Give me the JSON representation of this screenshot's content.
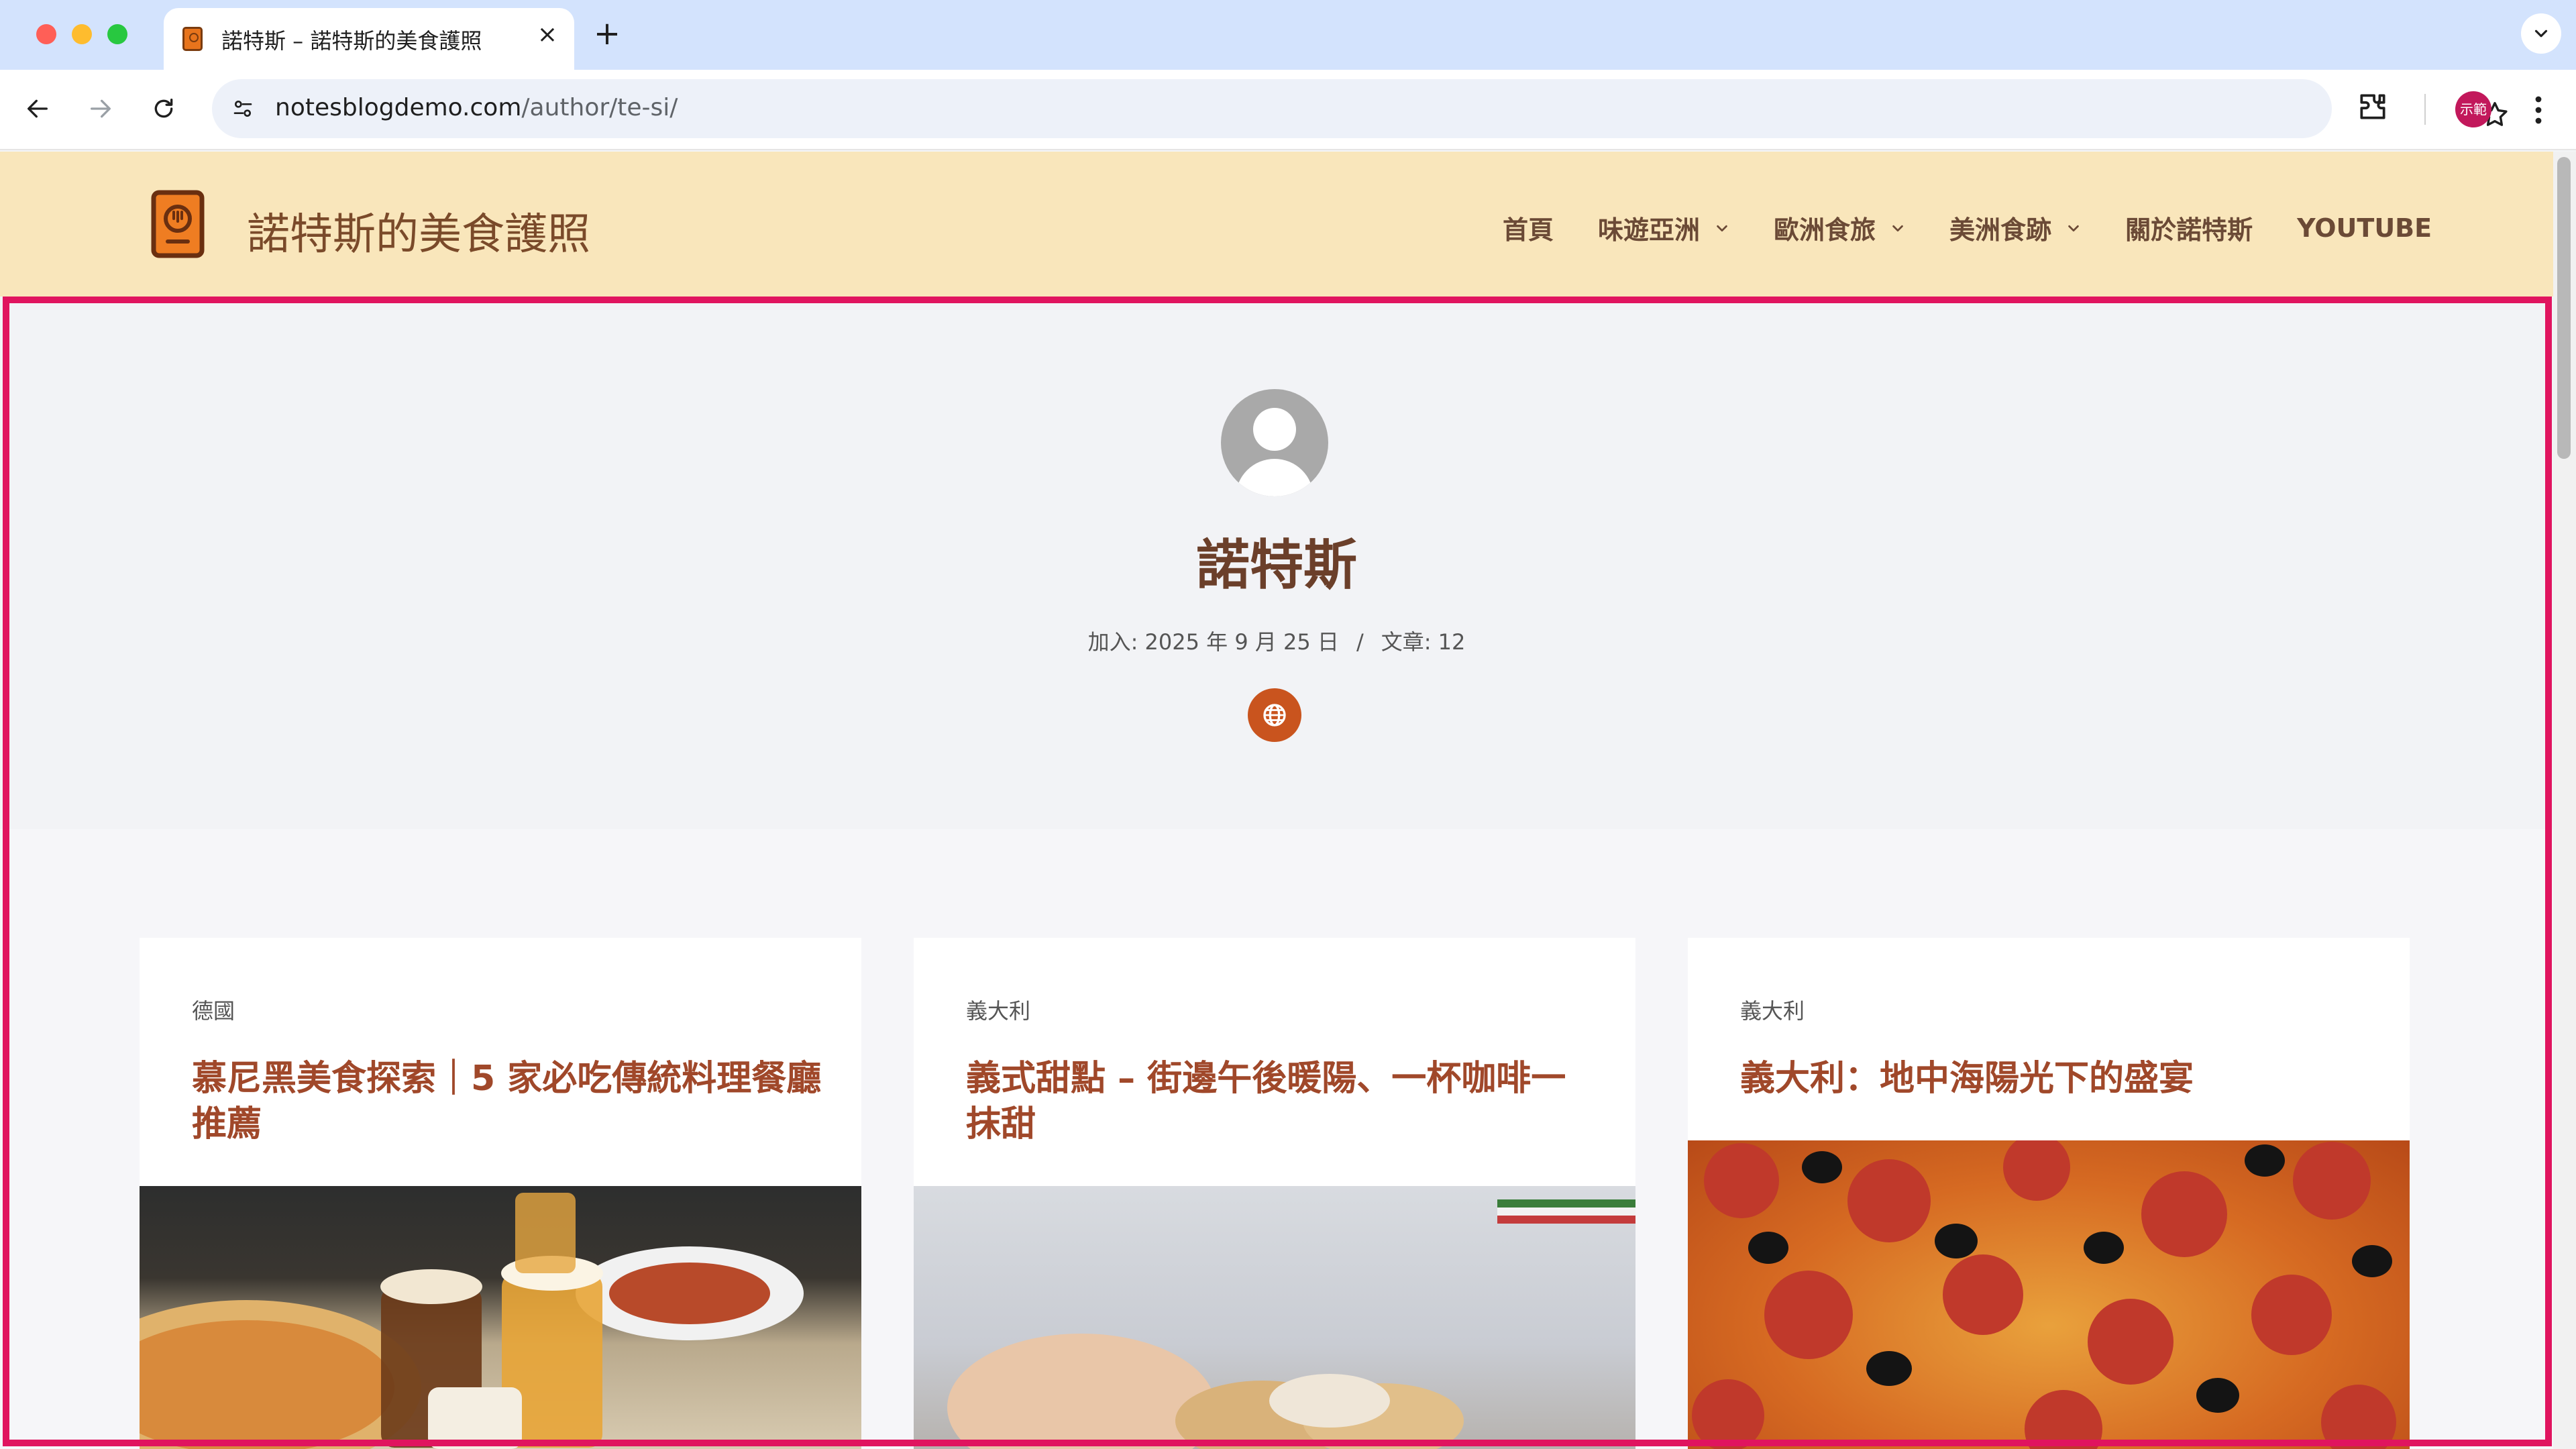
{
  "browser": {
    "tab_title": "諾特斯 – 諾特斯的美食護照",
    "tab_close": "×",
    "new_tab": "+",
    "url_host": "notesblogdemo.com",
    "url_path": "/author/te-si/",
    "profile_label": "示範"
  },
  "site": {
    "title": "諾特斯的美食護照",
    "nav": [
      {
        "label": "首頁",
        "has_dropdown": false
      },
      {
        "label": "味遊亞洲",
        "has_dropdown": true
      },
      {
        "label": "歐洲食旅",
        "has_dropdown": true
      },
      {
        "label": "美洲食跡",
        "has_dropdown": true
      },
      {
        "label": "關於諾特斯",
        "has_dropdown": false
      },
      {
        "label": "YOUTUBE",
        "has_dropdown": false
      }
    ]
  },
  "author": {
    "name": "諾特斯",
    "joined": "加入: 2025 年 9 月 25 日",
    "separator": "/",
    "posts": "文章: 12"
  },
  "posts": [
    {
      "category": "德國",
      "title": "慕尼黑美食探索｜5 家必吃傳統料理餐廳推薦"
    },
    {
      "category": "義大利",
      "title": "義式甜點 – 街邊午後暖陽、一杯咖啡一抹甜"
    },
    {
      "category": "義大利",
      "title": "義大利：地中海陽光下的盛宴"
    }
  ],
  "colors": {
    "header_bg": "#f9e6bb",
    "accent": "#c9541e",
    "title_brown": "#6b3f2a",
    "post_title": "#a0482a",
    "highlight": "#e0145f"
  }
}
